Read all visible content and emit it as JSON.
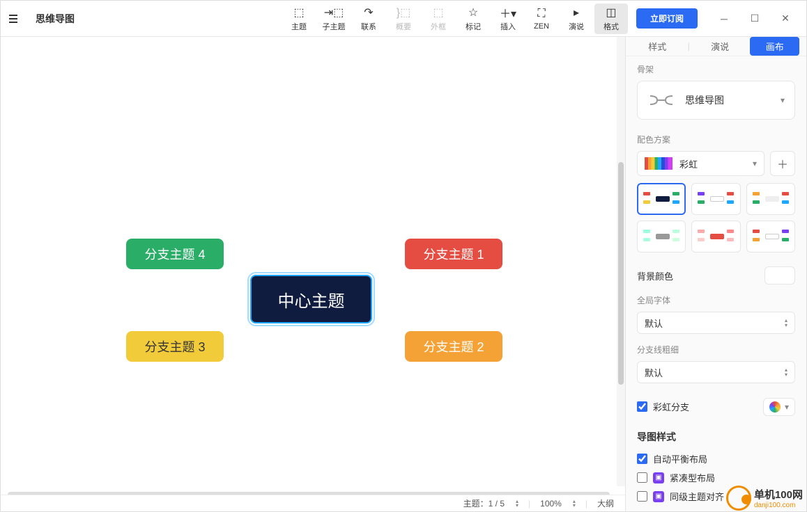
{
  "doc_title": "思维导图",
  "toolbar": {
    "topic": "主题",
    "subtopic": "子主题",
    "relation": "联系",
    "summary": "概要",
    "boundary": "外框",
    "marker": "标记",
    "insert": "插入",
    "zen": "ZEN",
    "present": "演说",
    "format": "格式"
  },
  "subscribe_label": "立即订阅",
  "mindmap": {
    "center": "中心主题",
    "b1": "分支主题 1",
    "b2": "分支主题 2",
    "b3": "分支主题 3",
    "b4": "分支主题 4"
  },
  "status": {
    "topic_count": "主题：1 / 5",
    "zoom": "100%",
    "outline": "大纲"
  },
  "panel": {
    "tabs": {
      "style": "样式",
      "present": "演说",
      "canvas": "画布"
    },
    "skeleton": {
      "label": "骨架",
      "value": "思维导图"
    },
    "color_scheme": {
      "label": "配色方案",
      "value": "彩虹"
    },
    "bg_color_label": "背景颜色",
    "global_font": {
      "label": "全局字体",
      "value": "默认"
    },
    "branch_width": {
      "label": "分支线粗细",
      "value": "默认"
    },
    "rainbow_branch_label": "彩虹分支",
    "map_style_title": "导图样式",
    "auto_balance_label": "自动平衡布局",
    "compact_label": "紧凑型布局",
    "sibling_align_label": "同级主题对齐"
  },
  "watermark": {
    "name": "单机100网",
    "url": "danji100.com"
  }
}
